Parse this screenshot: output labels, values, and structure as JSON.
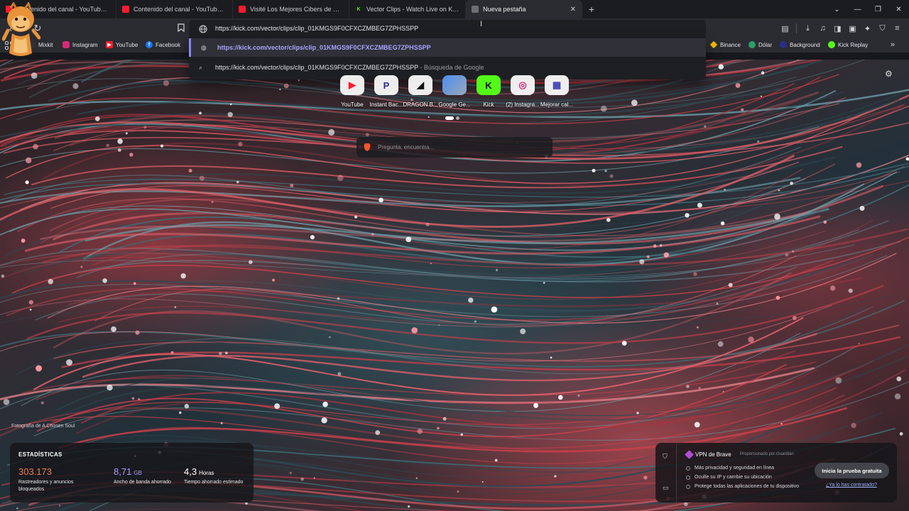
{
  "tabs": [
    {
      "title": "Contenido del canal - YouTube Studio",
      "favicon": "youtube-icon"
    },
    {
      "title": "Contenido del canal - YouTube Studio",
      "favicon": "youtube-icon"
    },
    {
      "title": "Visité Los Mejores Cibers de Dubai -",
      "favicon": "youtube-icon"
    },
    {
      "title": "Vector Clips - Watch Live on Kick",
      "favicon": "kick-icon"
    },
    {
      "title": "Nueva pestaña",
      "favicon": "brave-shield-icon",
      "active": true
    }
  ],
  "new_tab": "+",
  "url": "https://kick.com/vector/clips/clip_01KMGS9F0CFXCZMBEG7ZPHSSPP",
  "bookmarks": [
    {
      "label": "Mixkit",
      "icon": "mixkit-icon",
      "color": "#2f3136"
    },
    {
      "label": "Instagram",
      "icon": "instagram-icon",
      "color": "#d6287a"
    },
    {
      "label": "YouTube",
      "icon": "youtube-icon",
      "color": "#ff1b2d"
    },
    {
      "label": "Facebook",
      "icon": "facebook-icon",
      "color": "#1877f2"
    },
    {
      "label": "Binance",
      "icon": "binance-icon",
      "color": "#f0b90b"
    },
    {
      "label": "Dólar",
      "icon": "dolar-icon",
      "color": "#2e9e6a"
    },
    {
      "label": "Background",
      "icon": "background-icon",
      "color": "#2b2d8c"
    },
    {
      "label": "Kick Replay",
      "icon": "kick-replay-icon",
      "color": "#53fc18"
    }
  ],
  "omnibox": {
    "suggestion_url": "https://kick.com/vector/clips/clip_01KMGS9F0CFXCZMBEG7ZPHSSPP",
    "search_query": "https://kick.com/vector/clips/clip_01KMGS9F0CFXCZMBEG7ZPHSSPP",
    "search_suffix": " - Búsqueda de Google"
  },
  "top_sites": [
    {
      "label": "YouTube",
      "icon": "youtube-icon",
      "color": "#ff1b2d"
    },
    {
      "label": "Instant Bac...",
      "icon": "instant-background-icon",
      "color": "#2b2d8c"
    },
    {
      "label": "DRAGON B...",
      "icon": "dragon-icon",
      "color": "#111111"
    },
    {
      "label": "Google Ge...",
      "icon": "google-gemini-icon",
      "color": "#4a8ef0"
    },
    {
      "label": "Kick",
      "icon": "kick-icon",
      "color": "#53fc18"
    },
    {
      "label": "(2) Instagra...",
      "icon": "instagram-icon",
      "color": "#d6287a"
    },
    {
      "label": "Mejorar cal...",
      "icon": "mejorar-calidad-icon",
      "color": "#3b3fb0"
    }
  ],
  "search_placeholder": "Pregunta, encuentra...",
  "photo_credit": "Fotografía de A Chosen Soul",
  "stats": {
    "title": "ESTADÍSTICAS",
    "items": [
      {
        "value": "303.173",
        "unit": "",
        "desc": "Rastreadores y anuncios bloqueados",
        "color": "#f07a4e"
      },
      {
        "value": "8,71",
        "unit": "GB",
        "desc": "Ancho de banda ahorrado",
        "color": "#a49cff"
      },
      {
        "value": "4,3",
        "unit": "Horas",
        "desc": "Tiempo ahorrado estimado",
        "color": "#ffffff"
      }
    ]
  },
  "vpn": {
    "title": "VPN de Brave",
    "provided_by": "Proporcionado por  Guardian",
    "features": [
      "Más privacidad y seguridad en línea",
      "Oculte su IP y cambie su ubicación",
      "Protege todas las aplicaciones de tu dispositivo"
    ],
    "cta": "Inicia la prueba gratuita",
    "link": "¿Ya lo has contratado?"
  },
  "colors": {
    "accent": "#8b86ff",
    "tab_bg": "#1b1c20",
    "toolbar_bg": "#2b2c31"
  }
}
